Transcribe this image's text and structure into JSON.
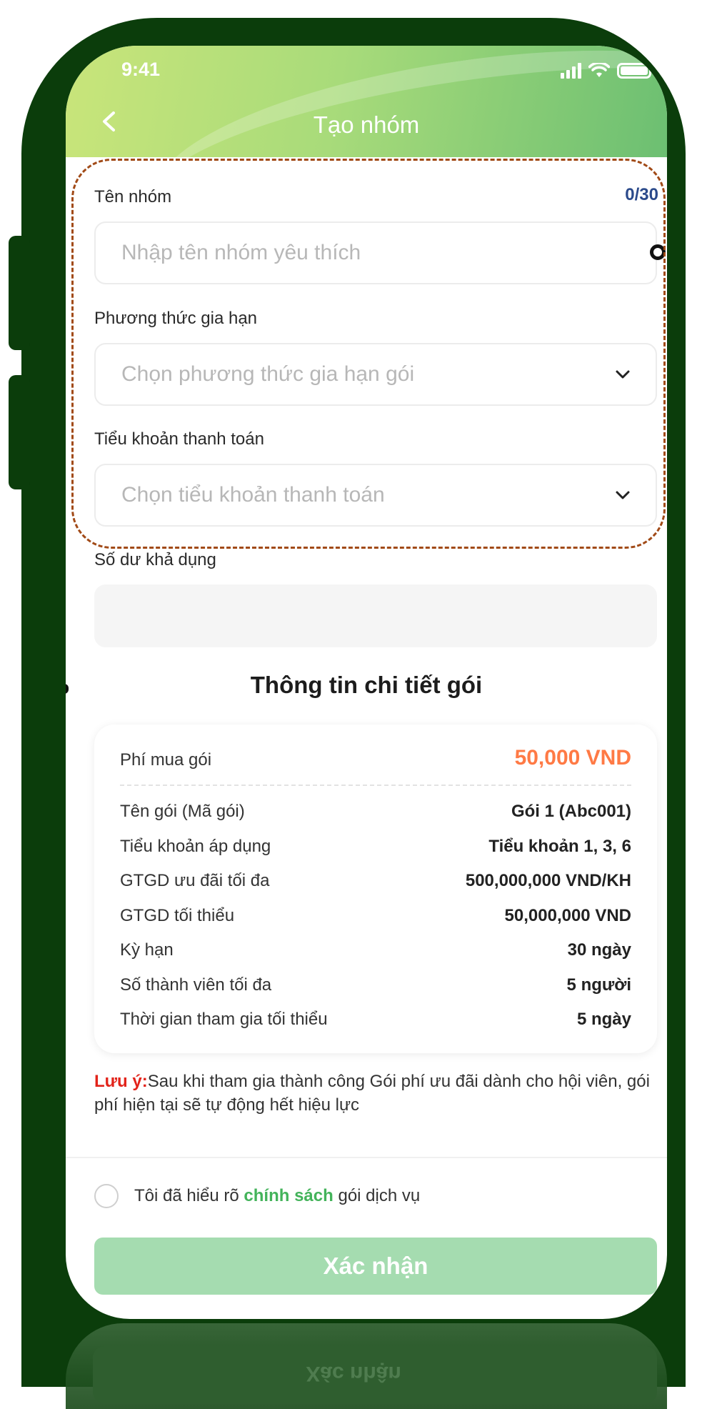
{
  "status_bar": {
    "time": "9:41"
  },
  "header": {
    "title": "Tạo nhóm"
  },
  "form": {
    "group_name": {
      "label": "Tên nhóm",
      "counter": "0/30",
      "placeholder": "Nhập tên nhóm yêu thích"
    },
    "renewal_method": {
      "label": "Phương thức gia hạn",
      "placeholder": "Chọn phương thức gia hạn gói"
    },
    "payment_subaccount": {
      "label": "Tiểu khoản thanh toán",
      "placeholder": "Chọn tiểu khoản thanh toán"
    },
    "available_balance": {
      "label": "Số dư khả dụng",
      "value": ""
    }
  },
  "package": {
    "title": "Thông tin chi tiết gói",
    "fee_label": "Phí mua gói",
    "fee_value": "50,000 VND",
    "rows": [
      {
        "label": "Tên gói (Mã gói)",
        "value": "Gói 1 (Abc001)"
      },
      {
        "label": "Tiểu khoản áp dụng",
        "value": "Tiểu khoản 1, 3, 6"
      },
      {
        "label": "GTGD ưu đãi tối đa",
        "value": "500,000,000 VND/KH"
      },
      {
        "label": "GTGD tối thiểu",
        "value": "50,000,000 VND"
      },
      {
        "label": "Kỳ hạn",
        "value": "30 ngày"
      },
      {
        "label": "Số thành viên tối đa",
        "value": "5 người"
      },
      {
        "label": "Thời gian tham gia tối thiểu",
        "value": "5 ngày"
      }
    ]
  },
  "note": {
    "prefix": "Lưu ý:",
    "text": "Sau khi tham gia thành công Gói phí ưu đãi dành cho hội viên, gói phí hiện tại sẽ tự động hết hiệu lực"
  },
  "policy": {
    "text_before": "Tôi đã hiểu rõ ",
    "link": "chính sách",
    "text_after": " gói dịch vụ"
  },
  "confirm_button": {
    "label": "Xác nhận"
  },
  "icons": {
    "back": "chevron-left-icon",
    "dropdown": "chevron-down-icon",
    "signal": "signal-icon",
    "wifi": "wifi-icon",
    "battery": "battery-icon"
  },
  "colors": {
    "header_start": "#c9e57a",
    "header_end": "#6cbf72",
    "fee": "#ff7a45",
    "note_prefix": "#e2231a",
    "link": "#43b35a",
    "button_disabled": "#a5dcb0",
    "device": "#0b3d0b",
    "highlight": "#a14a17"
  }
}
